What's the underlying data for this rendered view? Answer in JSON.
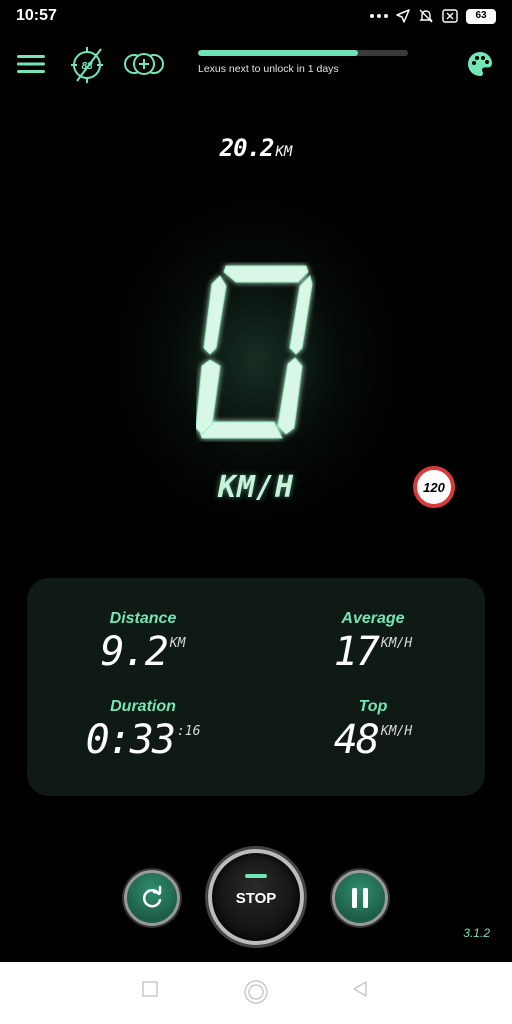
{
  "status": {
    "time": "10:57",
    "battery": "63",
    "icons": [
      "more-dots-icon",
      "location-arrow-icon",
      "bell-muted-icon",
      "close-box-icon",
      "battery-icon"
    ]
  },
  "topbar": {
    "icons": [
      "menu-icon",
      "speed-limit-88-icon",
      "add-plus-icon",
      "palette-icon"
    ],
    "limit_badge": "88",
    "unlock_progress": 0.76,
    "unlock_text": "Lexus next to unlock in 1 days"
  },
  "odometer": {
    "value": "20.2",
    "unit": "KM"
  },
  "speed": {
    "value": "0",
    "unit": "KM/H",
    "limit": "120"
  },
  "stats": {
    "distance": {
      "label": "Distance",
      "value": "9.2",
      "unit": "KM"
    },
    "average": {
      "label": "Average",
      "value": "17",
      "unit": "KM/H"
    },
    "duration": {
      "label": "Duration",
      "value": "0:33",
      "unit": ":16"
    },
    "top": {
      "label": "Top",
      "value": "48",
      "unit": "KM/H"
    }
  },
  "controls": {
    "reset_icon": "reset-icon",
    "stop_label": "STOP",
    "pause_icon": "pause-icon"
  },
  "version": "3.1.2",
  "colors": {
    "accent": "#74e6b6",
    "background": "#000000",
    "panel": "#0f1a15",
    "limit_ring": "#d93a3a"
  }
}
